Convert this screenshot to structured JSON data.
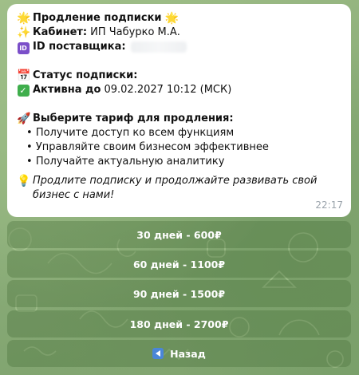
{
  "message": {
    "title": "Продление подписки",
    "cabinet_label": "Кабинет:",
    "cabinet_value": "ИП Чабурко М.А.",
    "supplier_id_label": "ID поставщика:",
    "status_label": "Статус подписки:",
    "status_active": "Активна до",
    "status_until": "09.02.2027 10:12 (МСК)",
    "tariff_header": "Выберите тариф для продления:",
    "bullets": [
      "Получите доступ ко всем функциям",
      "Управляйте своим бизнесом эффективнее",
      "Получайте актуальную аналитику"
    ],
    "promo": "Продлите подписку и продолжайте развивать свой бизнес с нами!",
    "time": "22:17"
  },
  "keyboard": {
    "buttons": [
      "30 дней - 600₽",
      "60 дней - 1100₽",
      "90 дней - 1500₽",
      "180 дней - 2700₽"
    ],
    "back": "Назад"
  },
  "icons": {
    "title_left": "glowing-star",
    "title_right": "glowing-star",
    "cabinet": "sparkles",
    "supplier_id": "id-symbol",
    "status": "calendar",
    "active": "check-mark-button",
    "tariff": "rocket",
    "promo": "light-bulb",
    "back": "back-arrow"
  },
  "colors": {
    "background": "#8fb07e",
    "bubble": "#ffffff",
    "keyboard_button": "#5e8a4f",
    "back_icon": "#4a86d8",
    "check": "#3fae4c",
    "id_badge": "#7b4fc9"
  }
}
